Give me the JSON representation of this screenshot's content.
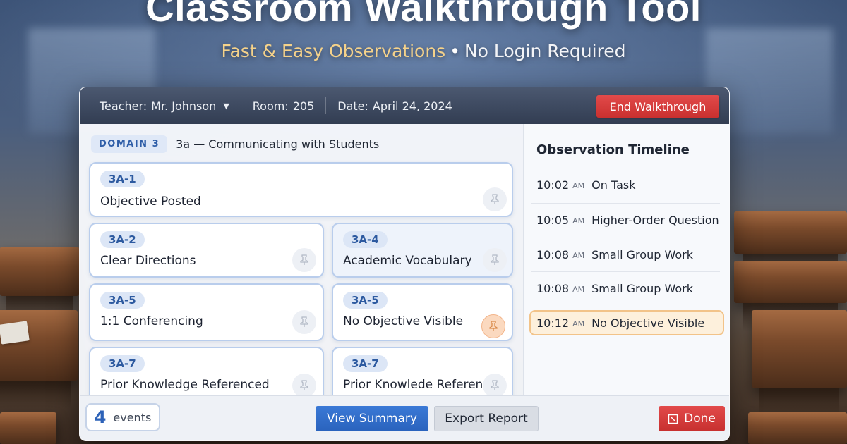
{
  "hero": {
    "title": "Classroom Walkthrough Tool",
    "subtitle_accent": "Fast & Easy Observations",
    "subtitle_sep": "•",
    "subtitle_rest": "No Login Required"
  },
  "topbar": {
    "teacher_label": "Teacher:",
    "teacher_value": "Mr. Johnson",
    "room_label": "Room:",
    "room_value": "205",
    "date_label": "Date:",
    "date_value": "April 24, 2024",
    "end_button": "End Walkthrough"
  },
  "domain": {
    "chip": "DOMAIN 3",
    "title": "3a — Communicating with Students"
  },
  "cards": [
    {
      "code": "3A-1",
      "label": "Objective Posted",
      "pin": "pin-icon",
      "active": false
    },
    {
      "code": "3A-2",
      "label": "Clear Directions",
      "pin": "pin-icon",
      "active": false
    },
    {
      "code": "3A-4",
      "label": "Academic Vocabulary",
      "pin": "pin-icon",
      "active": false
    },
    {
      "code": "3A-5",
      "label": "1:1 Conferencing",
      "pin": "pin-icon",
      "active": false
    },
    {
      "code": "3A-5",
      "label": "No Objective Visible",
      "pin": "pin-icon",
      "active": true
    },
    {
      "code": "3A-7",
      "label": "Prior Knowledge Referenced",
      "pin": "pin-icon",
      "active": false
    },
    {
      "code": "3A-7",
      "label": "Prior Knowlede Referenced",
      "pin": "pin-icon",
      "active": false
    }
  ],
  "timeline": {
    "title": "Observation Timeline",
    "entries": [
      {
        "time": "10:02",
        "ampm": "AM",
        "label": "On Task"
      },
      {
        "time": "10:05",
        "ampm": "AM",
        "label": "Higher-Order Question"
      },
      {
        "time": "10:08",
        "ampm": "AM",
        "label": "Small Group Work"
      },
      {
        "time": "10:08",
        "ampm": "AM",
        "label": "Small Group Work"
      },
      {
        "time": "10:12",
        "ampm": "AM",
        "label": "No Objective Visible",
        "highlighted": true
      }
    ]
  },
  "bottombar": {
    "event_count": "4",
    "event_word": "events",
    "view_summary": "View Summary",
    "export_report": "Export Report",
    "done": "Done"
  },
  "colors": {
    "accent_blue": "#2d62b8",
    "danger_red": "#d63a3a",
    "highlight_orange": "#f2c389",
    "subtitle_gold": "#f5d28a"
  }
}
